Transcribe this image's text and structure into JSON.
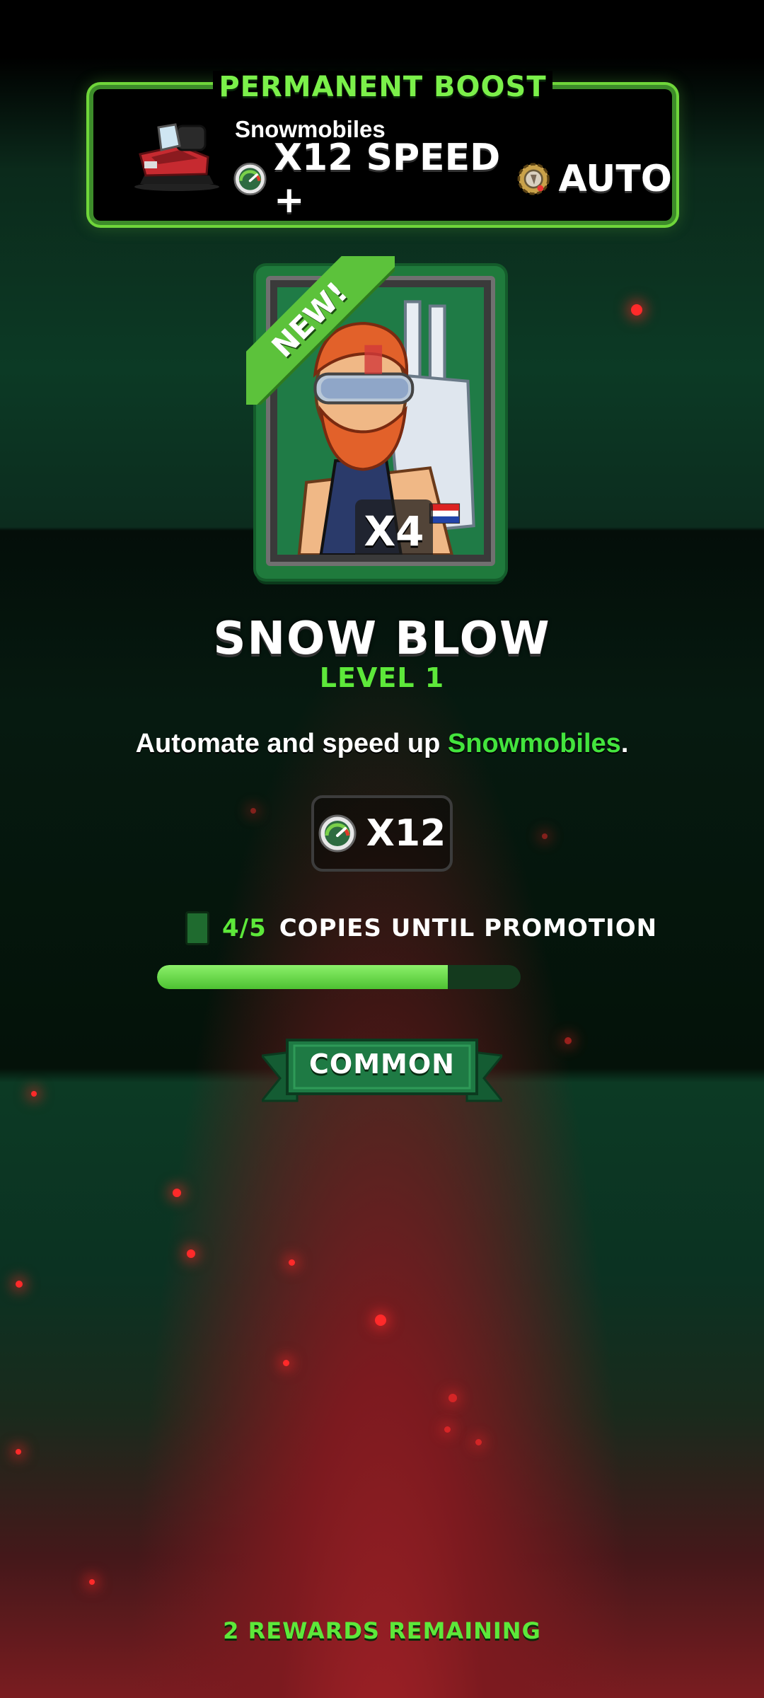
{
  "boost": {
    "title": "PERMANENT BOOST",
    "business": "Snowmobiles",
    "speed_text": "X12 SPEED +",
    "auto_text": "AUTO",
    "icons": [
      "snowmobile-icon",
      "speed-gauge-icon",
      "automation-gear-icon"
    ]
  },
  "card": {
    "new_label": "NEW!",
    "multiplier": "X4",
    "name": "SNOW BLOW",
    "level": "LEVEL 1"
  },
  "description": {
    "prefix": "Automate and speed up ",
    "highlight": "Snowmobiles",
    "suffix": "."
  },
  "stat": {
    "value": "X12",
    "icon": "speed-gauge-icon"
  },
  "promotion": {
    "count": "4/5",
    "label": "COPIES UNTIL PROMOTION",
    "progress": 0.8
  },
  "rarity": "COMMON",
  "remaining": "2 REWARDS REMAINING",
  "colors": {
    "accent_green": "#5de83a",
    "highlight_green": "#43e43d",
    "card_green": "#1f7a3c",
    "ember_red": "#ff2a2a"
  }
}
